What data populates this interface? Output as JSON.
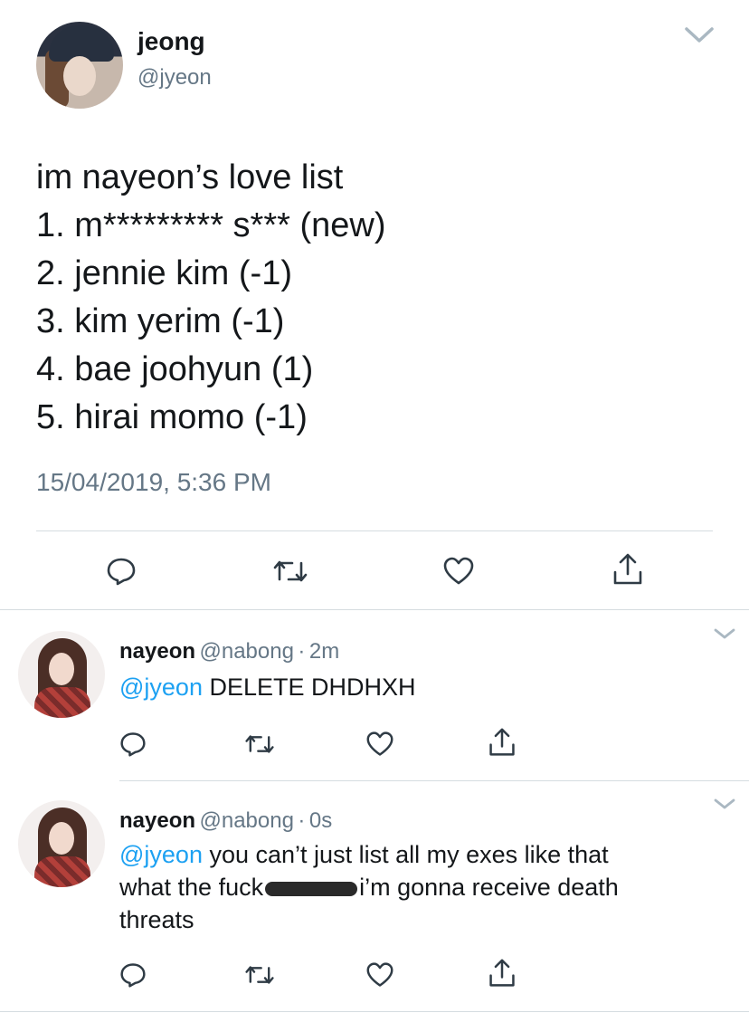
{
  "main_tweet": {
    "author_name": "jeong",
    "author_handle": "@jyeon",
    "lines": [
      "im nayeon’s love list",
      "1. m********* s*** (new)",
      "2. jennie kim (-1)",
      "3. kim yerim (-1)",
      "4. bae joohyun (1)",
      "5. hirai momo (-1)"
    ],
    "timestamp": "15/04/2019, 5:36 PM"
  },
  "replies": [
    {
      "author_name": "nayeon",
      "author_handle": "@nabong",
      "time": "2m",
      "mention": "@jyeon",
      "text": "DELETE DHDHXH"
    },
    {
      "author_name": "nayeon",
      "author_handle": "@nabong",
      "time": "0s",
      "mention": "@jyeon",
      "text_part1": "you can’t just list all my exes like that",
      "text_part2a": "what the fuck",
      "text_part2b": "i’m gonna receive death",
      "text_part3": "threats"
    }
  ],
  "icons": [
    "reply-icon",
    "retweet-icon",
    "like-icon",
    "share-icon",
    "chevron-down-icon"
  ],
  "colors": {
    "text": "#14171a",
    "secondary": "#657786",
    "link": "#1da1f2",
    "divider": "#d5dce0"
  }
}
